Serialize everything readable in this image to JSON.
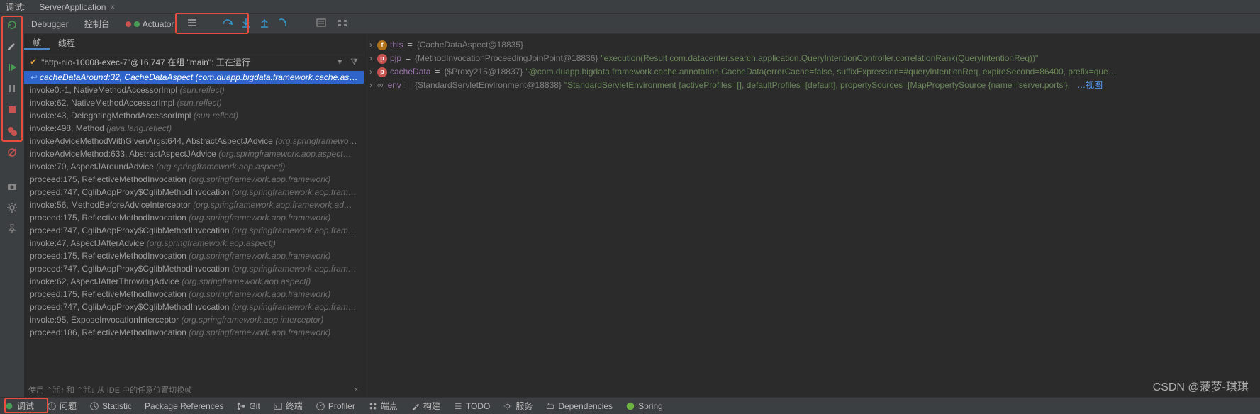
{
  "top": {
    "debug_label": "调试:",
    "app_name": "ServerApplication"
  },
  "toolbar": {
    "debugger": "Debugger",
    "console": "控制台",
    "actuator": "Actuator"
  },
  "frames_head": {
    "frames": "帧",
    "threads": "线程"
  },
  "thread": {
    "name": "\"http-nio-10008-exec-7\"@16,747 在组 \"main\": 正在运行"
  },
  "stack": [
    {
      "sel": true,
      "ret": true,
      "method": "cacheDataAround:32, CacheDataAspect",
      "pkg": "(com.duapp.bigdata.framework.cache.aspect)"
    },
    {
      "sel": false,
      "ret": false,
      "method": "invoke0:-1, NativeMethodAccessorImpl",
      "pkg": "(sun.reflect)"
    },
    {
      "sel": false,
      "ret": false,
      "method": "invoke:62, NativeMethodAccessorImpl",
      "pkg": "(sun.reflect)"
    },
    {
      "sel": false,
      "ret": false,
      "method": "invoke:43, DelegatingMethodAccessorImpl",
      "pkg": "(sun.reflect)"
    },
    {
      "sel": false,
      "ret": false,
      "method": "invoke:498, Method",
      "pkg": "(java.lang.reflect)"
    },
    {
      "sel": false,
      "ret": false,
      "method": "invokeAdviceMethodWithGivenArgs:644, AbstractAspectJAdvice",
      "pkg": "(org.springframework…"
    },
    {
      "sel": false,
      "ret": false,
      "method": "invokeAdviceMethod:633, AbstractAspectJAdvice",
      "pkg": "(org.springframework.aop.aspect…"
    },
    {
      "sel": false,
      "ret": false,
      "method": "invoke:70, AspectJAroundAdvice",
      "pkg": "(org.springframework.aop.aspectj)"
    },
    {
      "sel": false,
      "ret": false,
      "method": "proceed:175, ReflectiveMethodInvocation",
      "pkg": "(org.springframework.aop.framework)"
    },
    {
      "sel": false,
      "ret": false,
      "method": "proceed:747, CglibAopProxy$CglibMethodInvocation",
      "pkg": "(org.springframework.aop.fram…"
    },
    {
      "sel": false,
      "ret": false,
      "method": "invoke:56, MethodBeforeAdviceInterceptor",
      "pkg": "(org.springframework.aop.framework.ad…"
    },
    {
      "sel": false,
      "ret": false,
      "method": "proceed:175, ReflectiveMethodInvocation",
      "pkg": "(org.springframework.aop.framework)"
    },
    {
      "sel": false,
      "ret": false,
      "method": "proceed:747, CglibAopProxy$CglibMethodInvocation",
      "pkg": "(org.springframework.aop.fram…"
    },
    {
      "sel": false,
      "ret": false,
      "method": "invoke:47, AspectJAfterAdvice",
      "pkg": "(org.springframework.aop.aspectj)"
    },
    {
      "sel": false,
      "ret": false,
      "method": "proceed:175, ReflectiveMethodInvocation",
      "pkg": "(org.springframework.aop.framework)"
    },
    {
      "sel": false,
      "ret": false,
      "method": "proceed:747, CglibAopProxy$CglibMethodInvocation",
      "pkg": "(org.springframework.aop.fram…"
    },
    {
      "sel": false,
      "ret": false,
      "method": "invoke:62, AspectJAfterThrowingAdvice",
      "pkg": "(org.springframework.aop.aspectj)"
    },
    {
      "sel": false,
      "ret": false,
      "method": "proceed:175, ReflectiveMethodInvocation",
      "pkg": "(org.springframework.aop.framework)"
    },
    {
      "sel": false,
      "ret": false,
      "method": "proceed:747, CglibAopProxy$CglibMethodInvocation",
      "pkg": "(org.springframework.aop.fram…"
    },
    {
      "sel": false,
      "ret": false,
      "method": "invoke:95, ExposeInvocationInterceptor",
      "pkg": "(org.springframework.aop.interceptor)"
    },
    {
      "sel": false,
      "ret": false,
      "method": "proceed:186, ReflectiveMethodInvocation",
      "pkg": "(org.springframework.aop.framework)"
    }
  ],
  "hint": {
    "text": "使用 ⌃⌘↑ 和 ⌃⌘↓ 从 IDE 中的任意位置切换帧"
  },
  "vars": [
    {
      "badge": "f",
      "name": "this",
      "val": "{CacheDataAspect@18835}",
      "str": "",
      "link": ""
    },
    {
      "badge": "p",
      "name": "pjp",
      "val": "{MethodInvocationProceedingJoinPoint@18836}",
      "str": "\"execution(Result com.datacenter.search.application.QueryIntentionController.correlationRank(QueryIntentionReq))\"",
      "link": ""
    },
    {
      "badge": "p",
      "name": "cacheData",
      "val": "{$Proxy215@18837}",
      "str": "\"@com.duapp.bigdata.framework.cache.annotation.CacheData(errorCache=false, suffixExpression=#queryIntentionReq, expireSecond=86400, prefix=que…",
      "link": ""
    },
    {
      "badge": "oo",
      "name": "env",
      "val": "{StandardServletEnvironment@18838}",
      "str": "\"StandardServletEnvironment {activeProfiles=[], defaultProfiles=[default], propertySources=[MapPropertySource {name='server.ports'},",
      "link": "…视图"
    }
  ],
  "status": {
    "debug": "调试",
    "problems": "问题",
    "statistic": "Statistic",
    "pkgref": "Package References",
    "git": "Git",
    "terminal": "终端",
    "profiler": "Profiler",
    "endpoints": "端点",
    "build": "构建",
    "todo": "TODO",
    "services": "服务",
    "deps": "Dependencies",
    "spring": "Spring"
  },
  "watermark": "CSDN @菠萝-琪琪"
}
